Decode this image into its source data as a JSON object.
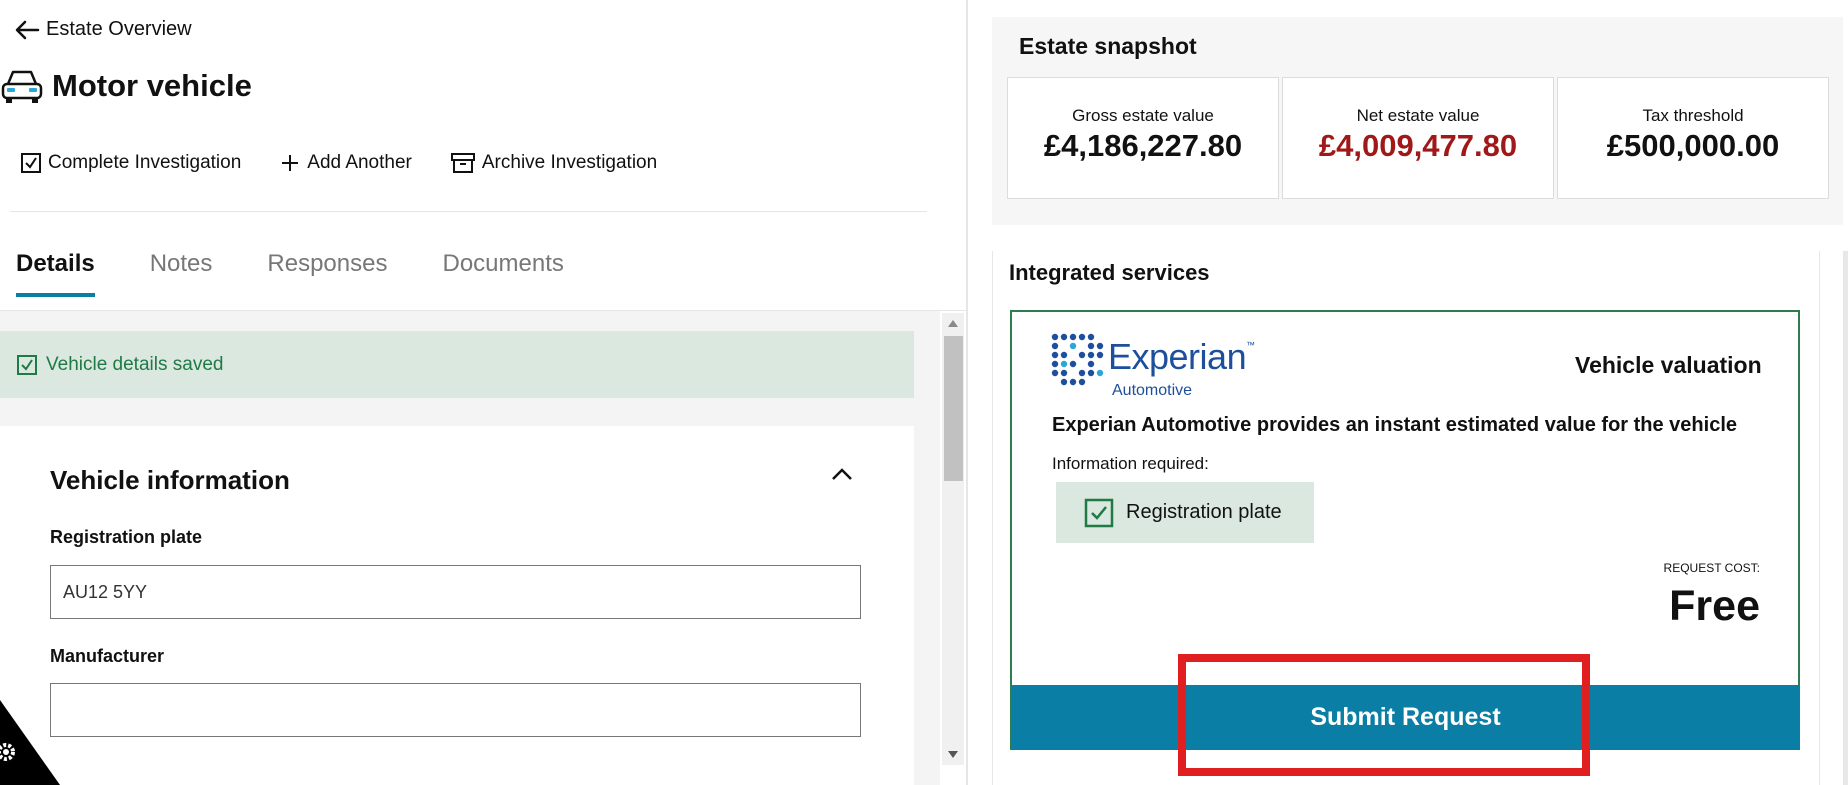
{
  "header": {
    "back_label": "Estate Overview",
    "page_title": "Motor vehicle"
  },
  "toolbar": {
    "complete_label": "Complete Investigation",
    "add_label": "Add Another",
    "archive_label": "Archive Investigation"
  },
  "tabs": [
    {
      "label": "Details",
      "active": true
    },
    {
      "label": "Notes",
      "active": false
    },
    {
      "label": "Responses",
      "active": false
    },
    {
      "label": "Documents",
      "active": false
    }
  ],
  "alert": {
    "message": "Vehicle details saved"
  },
  "vehicle_info": {
    "section_title": "Vehicle information",
    "registration_label": "Registration plate",
    "registration_value": "AU12 5YY",
    "manufacturer_label": "Manufacturer",
    "manufacturer_value": ""
  },
  "snapshot": {
    "title": "Estate snapshot",
    "stats": [
      {
        "label": "Gross estate value",
        "value": "£4,186,227.80"
      },
      {
        "label": "Net estate value",
        "value": "£4,009,477.80"
      },
      {
        "label": "Tax threshold",
        "value": "£500,000.00"
      }
    ]
  },
  "services": {
    "title": "Integrated services",
    "provider_name": "Experian",
    "provider_tm": "™",
    "provider_sub": "Automotive",
    "service_name": "Vehicle valuation",
    "description": "Experian Automotive provides an instant estimated value for the vehicle",
    "info_required_label": "Information required:",
    "required_item": "Registration plate",
    "cost_label": "REQUEST COST:",
    "cost_value": "Free",
    "submit_label": "Submit Request"
  },
  "colors": {
    "accent": "#0a7ea4",
    "success_bg": "#dbe8df",
    "success_text": "#1f7a46",
    "net_value": "#a01818",
    "highlight": "#e02020"
  }
}
